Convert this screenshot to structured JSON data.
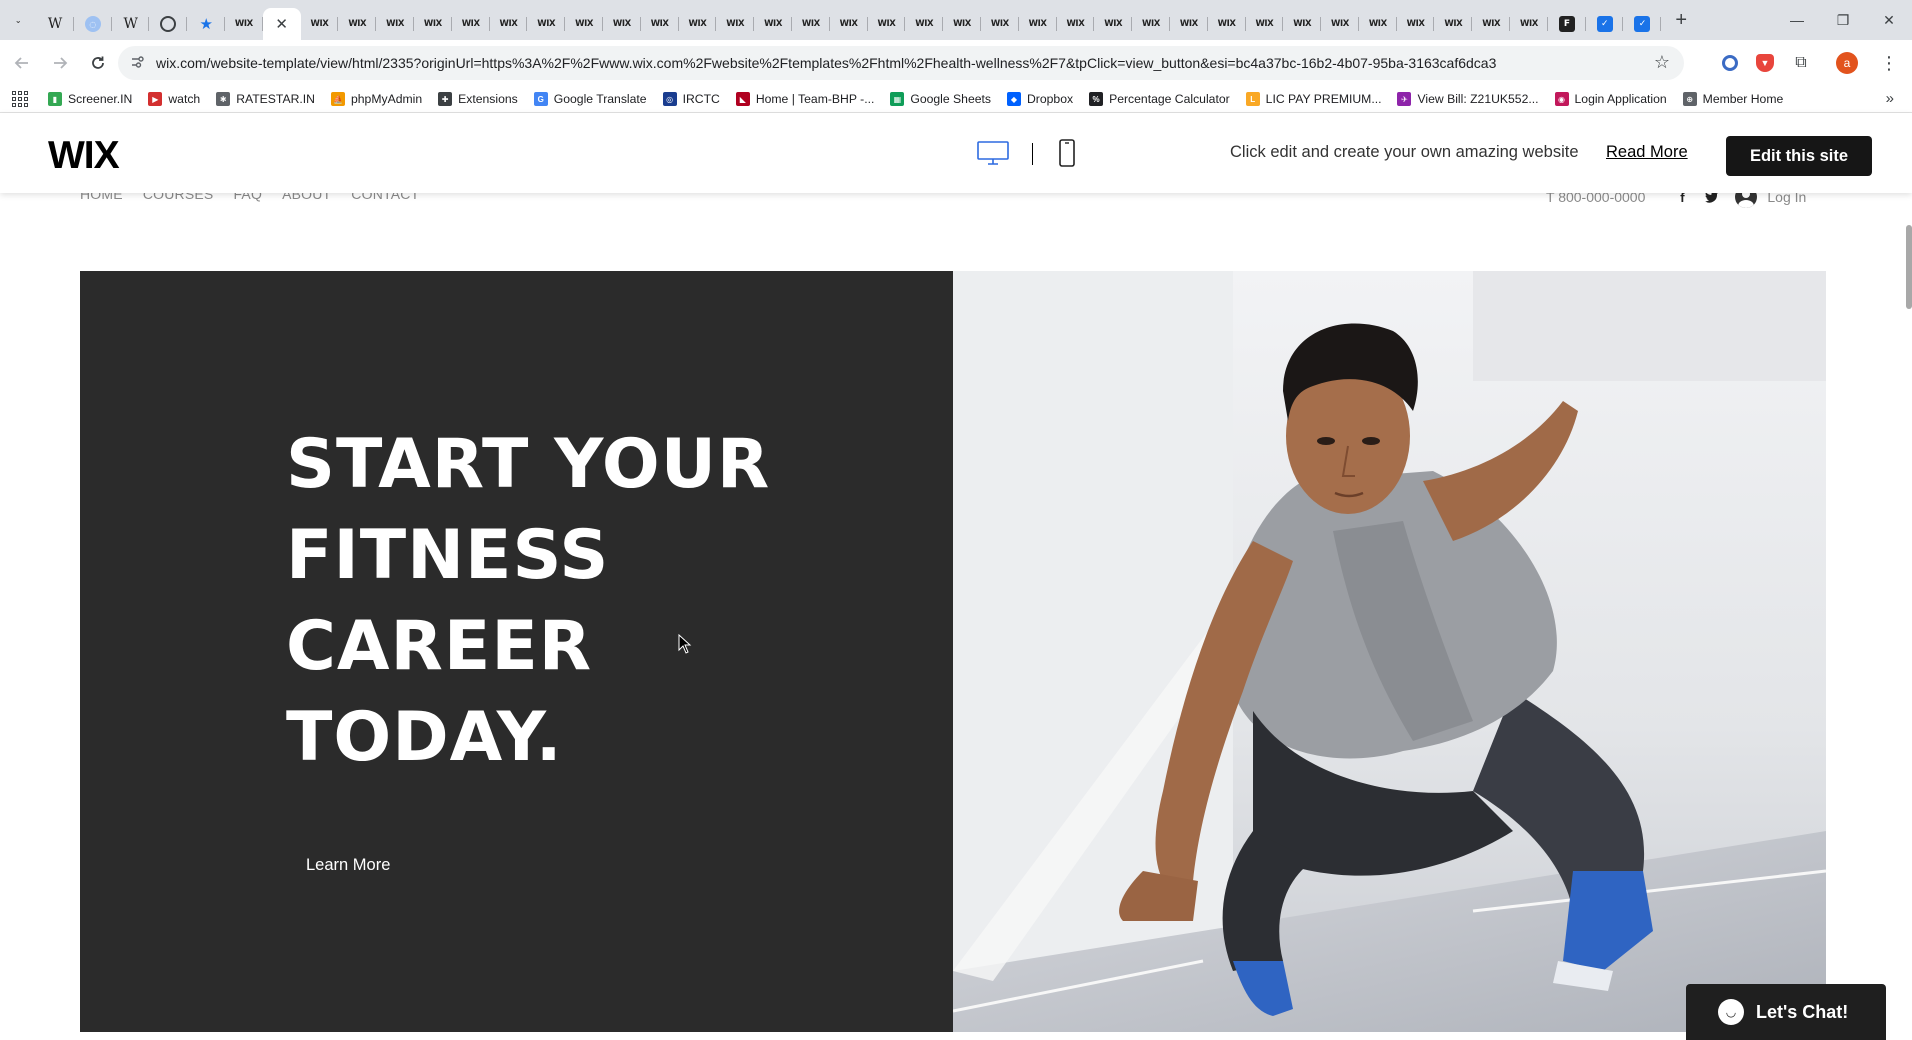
{
  "browser": {
    "tabs": [
      {
        "icon": "chevron-down-icon",
        "glyph": "⌄"
      },
      {
        "icon": "wikipedia-icon",
        "glyph": "W",
        "cls": "w"
      },
      {
        "icon": "globe-icon",
        "glyph": "◌",
        "cls": "globe"
      },
      {
        "icon": "wikipedia-icon",
        "glyph": "W",
        "cls": "w"
      },
      {
        "icon": "openai-icon",
        "glyph": "",
        "cls": "gear"
      },
      {
        "icon": "star-icon",
        "glyph": "★",
        "cls": "star"
      },
      {
        "icon": "wix-icon",
        "glyph": "WIX",
        "cls": "wix"
      },
      {
        "icon": "close-icon",
        "glyph": "✕",
        "active": true
      },
      {
        "icon": "wix-icon",
        "glyph": "WIX",
        "cls": "wix"
      },
      {
        "icon": "wix-icon",
        "glyph": "WIX",
        "cls": "wix"
      },
      {
        "icon": "wix-icon",
        "glyph": "WIX",
        "cls": "wix"
      },
      {
        "icon": "wix-icon",
        "glyph": "WIX",
        "cls": "wix"
      },
      {
        "icon": "wix-icon",
        "glyph": "WIX",
        "cls": "wix"
      },
      {
        "icon": "wix-icon",
        "glyph": "WIX",
        "cls": "wix"
      },
      {
        "icon": "wix-icon",
        "glyph": "WIX",
        "cls": "wix"
      },
      {
        "icon": "wix-icon",
        "glyph": "WIX",
        "cls": "wix"
      },
      {
        "icon": "wix-icon",
        "glyph": "WIX",
        "cls": "wix"
      },
      {
        "icon": "wix-icon",
        "glyph": "WIX",
        "cls": "wix"
      },
      {
        "icon": "wix-icon",
        "glyph": "WIX",
        "cls": "wix"
      },
      {
        "icon": "wix-icon",
        "glyph": "WIX",
        "cls": "wix"
      },
      {
        "icon": "wix-icon",
        "glyph": "WIX",
        "cls": "wix"
      },
      {
        "icon": "wix-icon",
        "glyph": "WIX",
        "cls": "wix"
      },
      {
        "icon": "wix-icon",
        "glyph": "WIX",
        "cls": "wix"
      },
      {
        "icon": "wix-icon",
        "glyph": "WIX",
        "cls": "wix"
      },
      {
        "icon": "wix-icon",
        "glyph": "WIX",
        "cls": "wix"
      },
      {
        "icon": "wix-icon",
        "glyph": "WIX",
        "cls": "wix"
      },
      {
        "icon": "wix-icon",
        "glyph": "WIX",
        "cls": "wix"
      },
      {
        "icon": "wix-icon",
        "glyph": "WIX",
        "cls": "wix"
      },
      {
        "icon": "wix-icon",
        "glyph": "WIX",
        "cls": "wix"
      },
      {
        "icon": "wix-icon",
        "glyph": "WIX",
        "cls": "wix"
      },
      {
        "icon": "wix-icon",
        "glyph": "WIX",
        "cls": "wix"
      },
      {
        "icon": "wix-icon",
        "glyph": "WIX",
        "cls": "wix"
      },
      {
        "icon": "wix-icon",
        "glyph": "WIX",
        "cls": "wix"
      },
      {
        "icon": "wix-icon",
        "glyph": "WIX",
        "cls": "wix"
      },
      {
        "icon": "wix-icon",
        "glyph": "WIX",
        "cls": "wix"
      },
      {
        "icon": "wix-icon",
        "glyph": "WIX",
        "cls": "wix"
      },
      {
        "icon": "wix-icon",
        "glyph": "WIX",
        "cls": "wix"
      },
      {
        "icon": "wix-icon",
        "glyph": "WIX",
        "cls": "wix"
      },
      {
        "icon": "wix-icon",
        "glyph": "WIX",
        "cls": "wix"
      },
      {
        "icon": "wix-icon",
        "glyph": "WIX",
        "cls": "wix"
      },
      {
        "icon": "wix-icon",
        "glyph": "WIX",
        "cls": "wix"
      },
      {
        "icon": "bookmark-app-icon",
        "glyph": "F",
        "cls": "blk"
      },
      {
        "icon": "bookmark-app-icon",
        "glyph": "✓",
        "cls": "blue"
      },
      {
        "icon": "bookmark-app-icon",
        "glyph": "✓",
        "cls": "blue"
      }
    ],
    "new_tab_glyph": "+",
    "window_controls": {
      "minimize": "—",
      "restore": "❐",
      "close": "✕"
    },
    "url": "wix.com/website-template/view/html/2335?originUrl=https%3A%2F%2Fwww.wix.com%2Fwebsite%2Ftemplates%2Fhtml%2Fhealth-wellness%2F7&tpClick=view_button&esi=bc4a37bc-16b2-4b07-95ba-3163caf6dca3",
    "profile_initial": "a",
    "profile_color": "#e2531d",
    "bookmarks": [
      {
        "label": "Screener.IN",
        "color": "#34a853",
        "glyph": "▮"
      },
      {
        "label": "watch",
        "color": "#d32f2f",
        "glyph": "▶"
      },
      {
        "label": "RATESTAR.IN",
        "color": "#5f6368",
        "glyph": "✱"
      },
      {
        "label": "phpMyAdmin",
        "color": "#f29900",
        "glyph": "⛵"
      },
      {
        "label": "Extensions",
        "color": "#3c4043",
        "glyph": "✚"
      },
      {
        "label": "Google Translate",
        "color": "#4285f4",
        "glyph": "G"
      },
      {
        "label": "IRCTC",
        "color": "#1a3d8f",
        "glyph": "◎"
      },
      {
        "label": "Home | Team-BHP -...",
        "color": "#b00020",
        "glyph": "◣"
      },
      {
        "label": "Google Sheets",
        "color": "#0f9d58",
        "glyph": "▦"
      },
      {
        "label": "Dropbox",
        "color": "#0061fe",
        "glyph": "◆"
      },
      {
        "label": "Percentage Calculator",
        "color": "#202124",
        "glyph": "%"
      },
      {
        "label": "LIC PAY PREMIUM...",
        "color": "#f9a825",
        "glyph": "L"
      },
      {
        "label": "View Bill: Z21UK552...",
        "color": "#8e24aa",
        "glyph": "✈"
      },
      {
        "label": "Login Application",
        "color": "#c2185b",
        "glyph": "◉"
      },
      {
        "label": "Member Home",
        "color": "#5f6368",
        "glyph": "⊕"
      }
    ]
  },
  "wixbar": {
    "logo": "WIX",
    "promo": "Click edit and create your own amazing website",
    "read_more": "Read More",
    "edit_button": "Edit this site"
  },
  "site": {
    "nav": [
      "HOME",
      "COURSES",
      "FAQ",
      "ABOUT",
      "CONTACT"
    ],
    "phone": "T 800-000-0000",
    "login": "Log In",
    "hero_title_lines": [
      "START YOUR",
      "FITNESS",
      "CAREER",
      "TODAY."
    ],
    "learn_more": "Learn More",
    "hero_bg": "#2b2b2b",
    "chat_label": "Let's Chat!"
  }
}
